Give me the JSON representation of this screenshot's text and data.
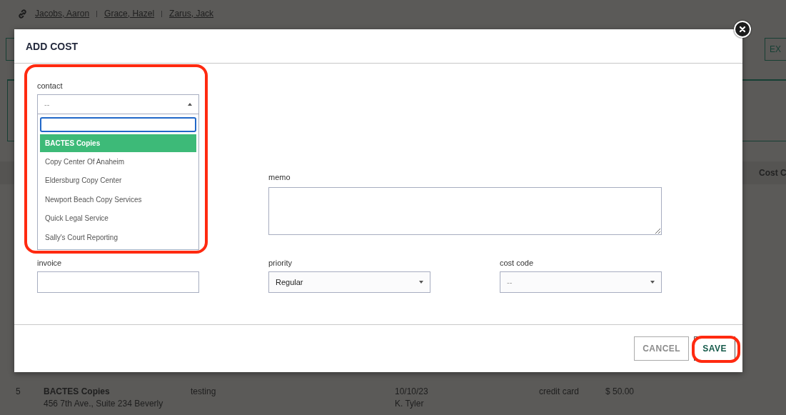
{
  "background": {
    "linked_contacts": [
      "Jacobs, Aaron",
      "Grace, Hazel",
      "Zarus, Jack"
    ],
    "button": "EX",
    "table": {
      "header_cut": "Cost C",
      "row": {
        "number": "5",
        "name": "BACTES Copies",
        "address": [
          "456 7th Ave., Suite 234 Beverly"
        ],
        "memo": "testing",
        "date": "10/10/23",
        "user": "K. Tyler",
        "method": "credit card",
        "amount": "$ 50.00"
      }
    }
  },
  "dialog": {
    "title": "ADD COST",
    "contact": {
      "label": "contact",
      "placeholder": "--",
      "highlighted": true,
      "expanded": true,
      "options": [
        {
          "label": "BACTES Copies",
          "selected": true
        },
        {
          "label": "Copy Center Of Anaheim",
          "selected": false
        },
        {
          "label": "Eldersburg Copy Center",
          "selected": false
        },
        {
          "label": "Newport Beach Copy Services",
          "selected": false
        },
        {
          "label": "Quick Legal Service",
          "selected": false
        },
        {
          "label": "Sally's Court Reporting",
          "selected": false
        }
      ]
    },
    "memo": {
      "label": "memo"
    },
    "invoice": {
      "label": "invoice"
    },
    "priority": {
      "label": "priority",
      "value": "Regular"
    },
    "cost_code": {
      "label": "cost code",
      "placeholder": "--"
    },
    "buttons": [
      {
        "label": "CANCEL",
        "kind": "secondary",
        "highlighted": false
      },
      {
        "label": "SAVE",
        "kind": "primary",
        "highlighted": true
      }
    ]
  }
}
